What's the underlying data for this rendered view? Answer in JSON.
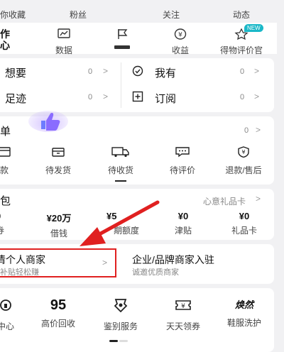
{
  "top_stats": [
    "你收藏",
    "粉丝",
    "关注",
    "动态"
  ],
  "creator": {
    "title_line1": "作",
    "title_line2": "心",
    "items": [
      {
        "label": "数据",
        "icon": "chart-icon"
      },
      {
        "label": "",
        "icon": "flag-icon"
      },
      {
        "label": "收益",
        "icon": "yen-coin-icon"
      },
      {
        "label": "得物评价官",
        "icon": "star-badge-icon",
        "badge": "NEW"
      }
    ]
  },
  "lists": {
    "want": {
      "label": "想要",
      "count": "0"
    },
    "have": {
      "label": "我有",
      "count": "0"
    },
    "footprint": {
      "label": "足迹",
      "count": "0"
    },
    "subscribe": {
      "label": "订阅",
      "count": "0"
    }
  },
  "orders": {
    "title": "单",
    "count": "0",
    "items": [
      "款",
      "待发货",
      "待收货",
      "待评价",
      "退款/售后"
    ]
  },
  "wallet": {
    "title": "包",
    "gift_card_link": "心意礼品卡",
    "items": [
      {
        "value": "0",
        "label": "券"
      },
      {
        "value": "¥20万",
        "label": "借钱"
      },
      {
        "value": "¥5",
        "label": "期额度"
      },
      {
        "value": "¥0",
        "label": "津贴"
      },
      {
        "value": "¥0",
        "label": "礼品卡"
      }
    ]
  },
  "merchant": {
    "personal_title": "清个人商家",
    "personal_sub": "补贴轻松赚",
    "brand_title": "企业/品牌商家入驻",
    "brand_sub": "诚邀优质商家"
  },
  "services": [
    {
      "label": "中心",
      "icon": "service-icon"
    },
    {
      "label": "高价回收",
      "icon": "recycle-95-icon",
      "glyph": "95"
    },
    {
      "label": "鉴别服务",
      "icon": "appraisal-icon"
    },
    {
      "label": "天天领券",
      "icon": "coupon-icon",
      "glyph": "¥"
    },
    {
      "label": "鞋服洗护",
      "icon": "wash-icon",
      "glyph": "焕然"
    }
  ],
  "colors": {
    "annotation_red": "#e02020",
    "accent_purple": "#7b5cff"
  }
}
